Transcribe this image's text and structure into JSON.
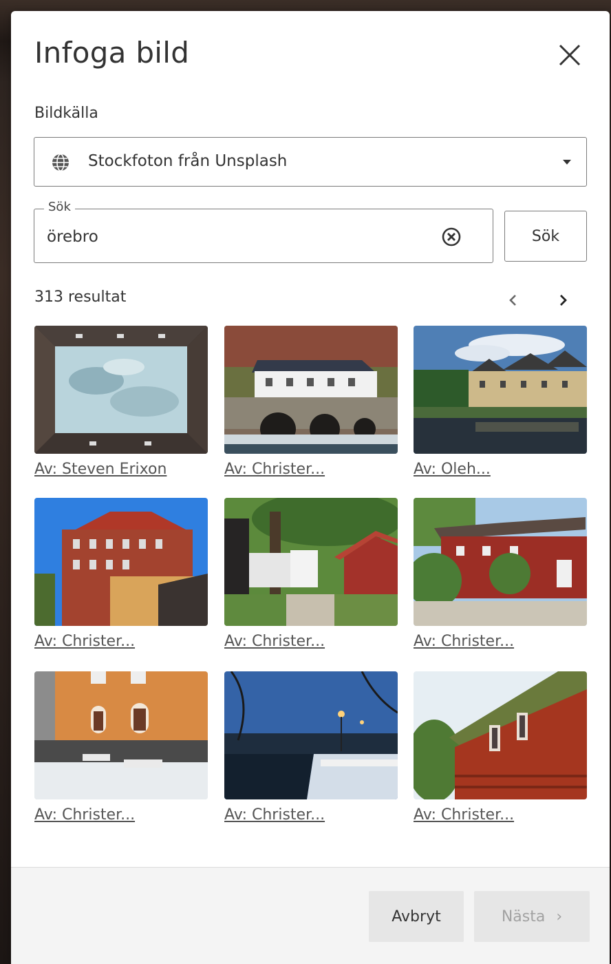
{
  "dialog": {
    "title": "Infoga bild",
    "close_icon": "close-icon"
  },
  "source": {
    "label": "Bildkälla",
    "selected": "Stockfoton från Unsplash",
    "icon": "globe-icon"
  },
  "search": {
    "legend": "Sök",
    "value": "örebro",
    "button_label": "Sök",
    "clear_icon": "clear-circle-x-icon"
  },
  "results": {
    "count_text": "313 resultat",
    "prev_icon": "chevron-left-icon",
    "next_icon": "chevron-right-icon",
    "items": [
      {
        "credit": "Av: Steven Erixon"
      },
      {
        "credit": "Av: Christer..."
      },
      {
        "credit": "Av: Oleh..."
      },
      {
        "credit": "Av: Christer..."
      },
      {
        "credit": "Av: Christer..."
      },
      {
        "credit": "Av: Christer..."
      },
      {
        "credit": "Av: Christer..."
      },
      {
        "credit": "Av: Christer..."
      },
      {
        "credit": "Av: Christer..."
      }
    ]
  },
  "footer": {
    "cancel_label": "Avbryt",
    "next_label": "Nästa",
    "next_chevron": "›"
  }
}
